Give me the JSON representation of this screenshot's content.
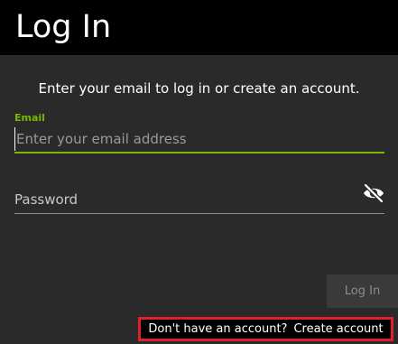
{
  "header": {
    "title": "Log In"
  },
  "intro": {
    "text": "Enter your email to log in or create an account."
  },
  "email": {
    "label": "Email",
    "placeholder": "Enter your email address",
    "value": ""
  },
  "password": {
    "placeholder": "Password",
    "value": "",
    "toggle_icon": "eye-slash-icon"
  },
  "login_button": {
    "label": "Log In"
  },
  "signup": {
    "question": "Don't have an account?",
    "link": "Create account"
  },
  "colors": {
    "accent": "#76b900",
    "highlight": "#e0212a",
    "header_bg": "#000000",
    "page_bg": "#2a2a2a"
  }
}
